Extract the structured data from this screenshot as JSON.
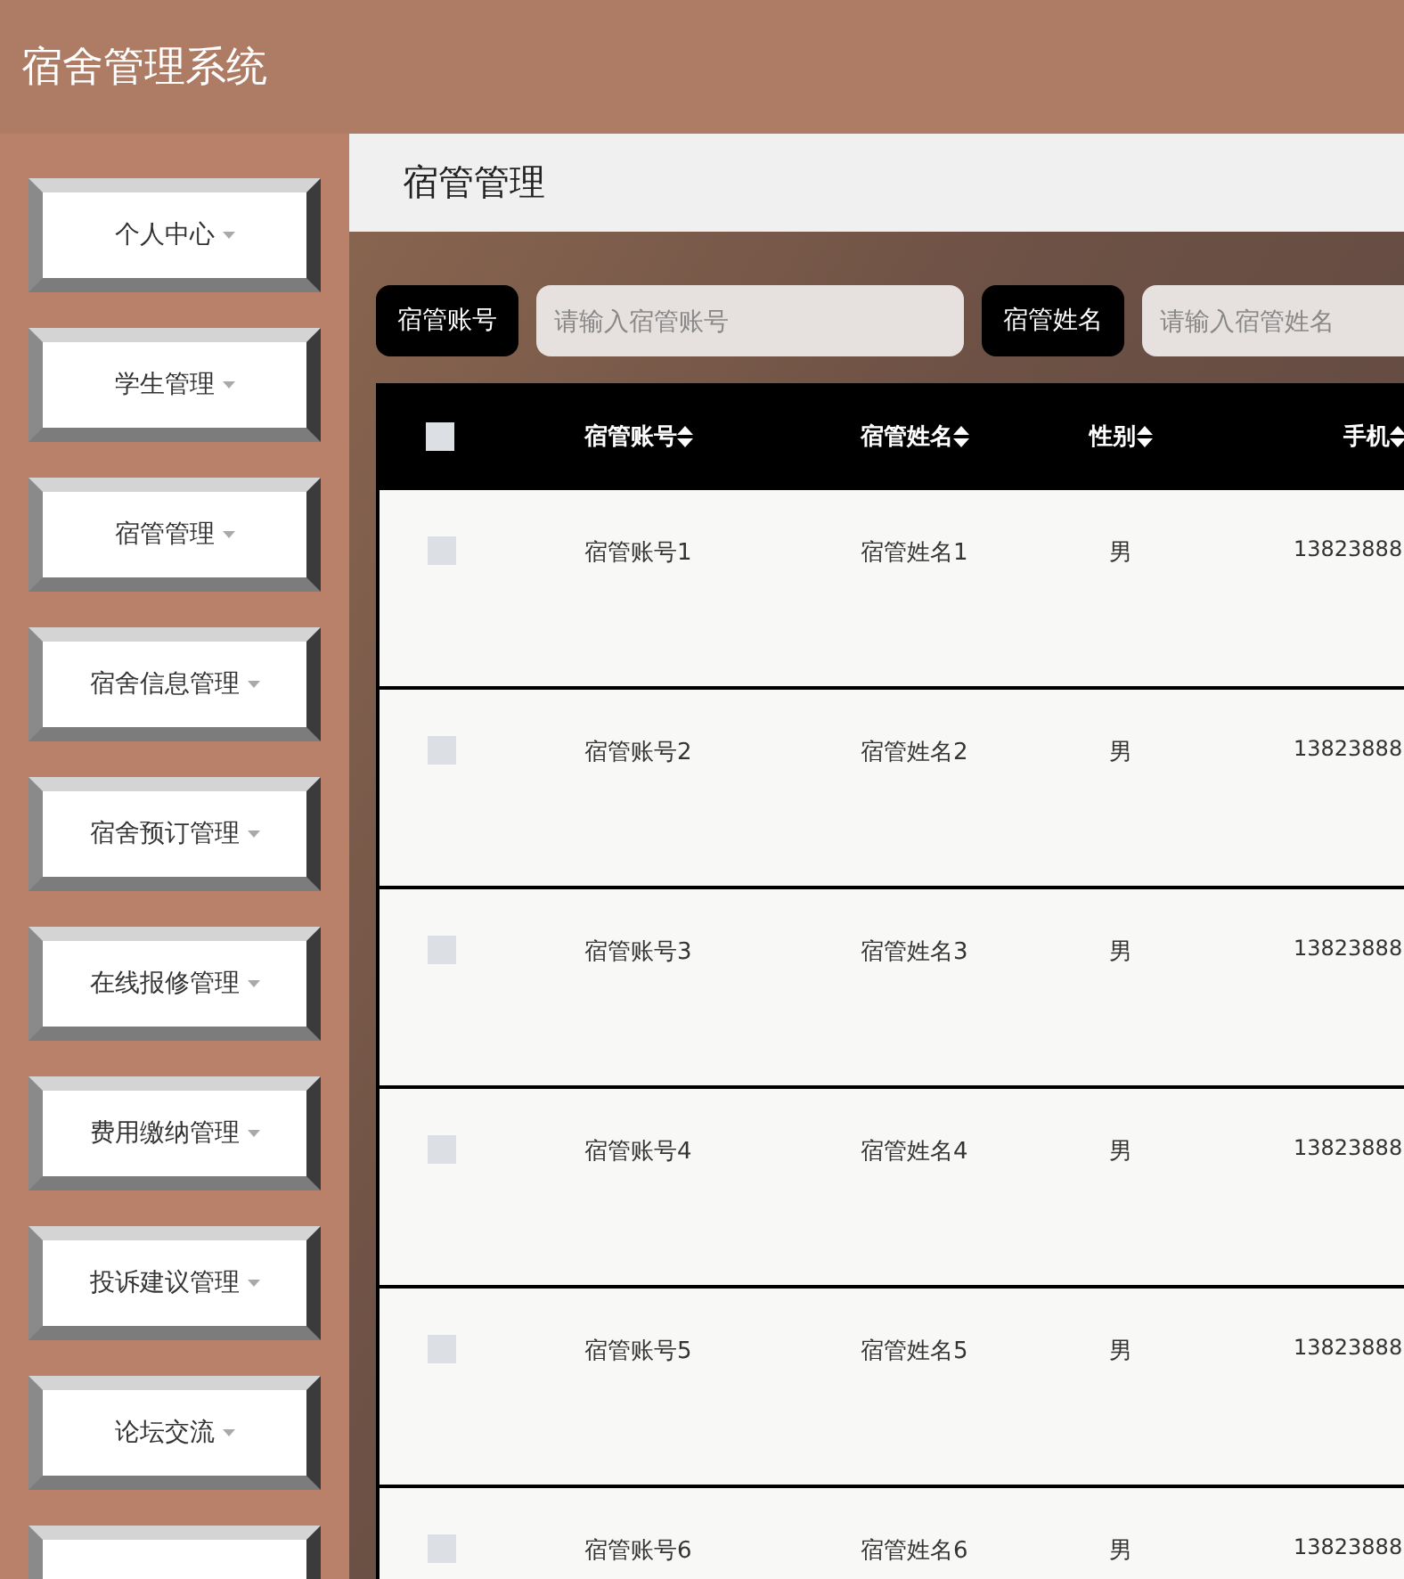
{
  "header": {
    "title": "宿舍管理系统"
  },
  "sidebar": {
    "items": [
      {
        "label": "个人中心"
      },
      {
        "label": "学生管理"
      },
      {
        "label": "宿管管理"
      },
      {
        "label": "宿舍信息管理"
      },
      {
        "label": "宿舍预订管理"
      },
      {
        "label": "在线报修管理"
      },
      {
        "label": "费用缴纳管理"
      },
      {
        "label": "投诉建议管理"
      },
      {
        "label": "论坛交流"
      }
    ],
    "more_below": true
  },
  "page_title": "宿管管理",
  "search": [
    {
      "label": "宿管账号",
      "placeholder": "请输入宿管账号"
    },
    {
      "label": "宿管姓名",
      "placeholder": "请输入宿管姓名"
    }
  ],
  "table": {
    "select_all": {
      "checked": false
    },
    "columns": [
      "宿管账号",
      "宿管姓名",
      "性别",
      "手机"
    ],
    "rows": [
      {
        "checked": false,
        "cells": [
          "宿管账号1",
          "宿管姓名1",
          "男",
          "13823888"
        ]
      },
      {
        "checked": false,
        "cells": [
          "宿管账号2",
          "宿管姓名2",
          "男",
          "13823888"
        ]
      },
      {
        "checked": false,
        "cells": [
          "宿管账号3",
          "宿管姓名3",
          "男",
          "13823888"
        ]
      },
      {
        "checked": false,
        "cells": [
          "宿管账号4",
          "宿管姓名4",
          "男",
          "13823888"
        ]
      },
      {
        "checked": false,
        "cells": [
          "宿管账号5",
          "宿管姓名5",
          "男",
          "13823888"
        ]
      },
      {
        "checked": false,
        "cells": [
          "宿管账号6",
          "宿管姓名6",
          "男",
          "13823888"
        ]
      }
    ]
  }
}
